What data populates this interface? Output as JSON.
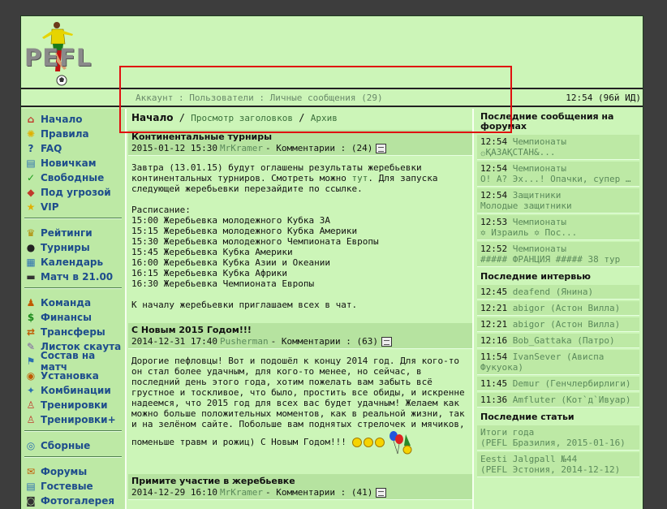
{
  "logo": {
    "text": "PEFL"
  },
  "topbar": {
    "links": [
      "Аккаунт",
      "Пользователи",
      "Личные сообщения"
    ],
    "separator": " : ",
    "messages_count": "(29)",
    "clock": "12:54 (96й ИД)"
  },
  "nav": {
    "groups": [
      [
        {
          "label": "Начало",
          "icon": "home-icon",
          "glyph": "⌂",
          "color": "#c0392b"
        },
        {
          "label": "Правила",
          "icon": "lightbulb-icon",
          "glyph": "✺",
          "color": "#e0b000"
        },
        {
          "label": "FAQ",
          "icon": "help-icon",
          "glyph": "?",
          "color": "#1e4d8c"
        },
        {
          "label": "Новичкам",
          "icon": "newbie-icon",
          "glyph": "▤",
          "color": "#2a6fb0"
        },
        {
          "label": "Свободные",
          "icon": "check-icon",
          "glyph": "✓",
          "color": "#1a9a1a"
        },
        {
          "label": "Под угрозой",
          "icon": "warning-icon",
          "glyph": "◆",
          "color": "#c0392b"
        },
        {
          "label": "VIP",
          "icon": "star-icon",
          "glyph": "★",
          "color": "#e0b000"
        }
      ],
      [
        {
          "label": "Рейтинги",
          "icon": "trophy-icon",
          "glyph": "♛",
          "color": "#b08a00"
        },
        {
          "label": "Турниры",
          "icon": "ball-icon",
          "glyph": "●",
          "color": "#222"
        },
        {
          "label": "Календарь",
          "icon": "calendar-icon",
          "glyph": "▦",
          "color": "#2a6fb0"
        },
        {
          "label": "Матч в 21.00",
          "icon": "tv-icon",
          "glyph": "▬",
          "color": "#333"
        }
      ],
      [
        {
          "label": "Команда",
          "icon": "team-icon",
          "glyph": "♟",
          "color": "#c05a00"
        },
        {
          "label": "Финансы",
          "icon": "money-icon",
          "glyph": "$",
          "color": "#1a8a1a"
        },
        {
          "label": "Трансферы",
          "icon": "transfer-icon",
          "glyph": "⇄",
          "color": "#c05a00"
        },
        {
          "label": "Листок скаута",
          "icon": "scout-icon",
          "glyph": "✎",
          "color": "#7a5aa0"
        },
        {
          "label": "Состав на матч",
          "icon": "lineup-icon",
          "glyph": "⚑",
          "color": "#2a6fb0"
        },
        {
          "label": "Установка",
          "icon": "tactics-icon",
          "glyph": "◉",
          "color": "#c05a00"
        },
        {
          "label": "Комбинации",
          "icon": "combo-icon",
          "glyph": "✦",
          "color": "#2a6fb0"
        },
        {
          "label": "Тренировки",
          "icon": "training-icon",
          "glyph": "♙",
          "color": "#c0392b"
        },
        {
          "label": "Тренировки+",
          "icon": "training-plus-icon",
          "glyph": "♙",
          "color": "#c0392b"
        }
      ],
      [
        {
          "label": "Сборные",
          "icon": "fifa-icon",
          "glyph": "◎",
          "color": "#2a6fb0"
        }
      ],
      [
        {
          "label": "Форумы",
          "icon": "forum-icon",
          "glyph": "✉",
          "color": "#c05a00"
        },
        {
          "label": "Гостевые",
          "icon": "guestbook-icon",
          "glyph": "▤",
          "color": "#2a6fb0"
        },
        {
          "label": "Фотогалерея",
          "icon": "camera-icon",
          "glyph": "◙",
          "color": "#333"
        }
      ]
    ]
  },
  "breadcrumb": {
    "home": "Начало",
    "sep": " / ",
    "items": [
      "Просмотр заголовков",
      "Архив"
    ]
  },
  "news": [
    {
      "title": "Континентальные турниры",
      "date": "2015-01-12 15:30",
      "author": "MrKramer",
      "comments_label": "- Комментарии :",
      "comments_count": "(24)",
      "intro_before": "Завтра (13.01.15) будут оглашены результаты жеребьевки континентальных турниров. Смотреть можно ",
      "intro_link": "тут",
      "intro_after": ". Для запуска следующей жеребьевки перезайдите по ссылке.",
      "schedule_title": "Расписание:",
      "schedule": [
        "15:00 Жеребьевка молодежного Кубка 3А",
        "15:15 Жеребьевка молодежного Кубка Америки",
        "15:30 Жеребьевка молодежного Чемпионата Европы",
        "15:45 Жеребьевка Кубка Америки",
        "16:00 Жеребьевка Кубка Азии и Океании",
        "16:15 Жеребьевка Кубка Африки",
        "16:30 Жеребьевка Чемпионата Европы"
      ],
      "outro": "К началу жеребьевки приглашаем всех в чат."
    },
    {
      "title": "С Новым 2015 Годом!!!",
      "date": "2014-12-31 17:40",
      "author": "Pusherman",
      "comments_label": "- Комментарии :",
      "comments_count": "(63)",
      "text": "Дорогие пефловцы! Вот и подошёл к концу 2014 год. Для кого-то он стал более удачным, для кого-то менее, но сейчас, в последний день этого года, хотим пожелать вам забыть всё грустное и тоскливое, что было, простить все обиды, и искренне надеемся, что 2015 год для всех вас будет удачным! Желаем как можно больше положительных моментов, как в реальной жизни, так и на зелёном сайте. Побольше вам поднятых стрелочек и мячиков, поменьше травм и рожиц) С Новым Годом!!!"
    },
    {
      "title": "Примите участие в жеребьевке",
      "date": "2014-12-29 16:10",
      "author": "MrKramer",
      "comments_label": "- Комментарии :",
      "comments_count": "(41)"
    }
  ],
  "right": {
    "forum_heading": "Последние сообщения на форумах",
    "forum": [
      {
        "time": "12:54",
        "cat": "Чемпионаты",
        "sub": "۞ҚАЗАҚСТАН&..."
      },
      {
        "time": "12:54",
        "cat": "Чемпионаты",
        "sub": "О! А? Эх...! Опачки, супер ин..."
      },
      {
        "time": "12:54",
        "cat": "Защитники",
        "sub": "Молодые защитники"
      },
      {
        "time": "12:53",
        "cat": "Чемпионаты",
        "sub": "✡ Израиль ✡ Пос..."
      },
      {
        "time": "12:52",
        "cat": "Чемпионаты",
        "sub": "##### ФРАНЦИЯ ##### 38 тур"
      }
    ],
    "interviews_heading": "Последние интервью",
    "interviews": [
      {
        "time": "12:45",
        "text": "deafend (Янина)"
      },
      {
        "time": "12:21",
        "text": "abigor (Астон Вилла)"
      },
      {
        "time": "12:21",
        "text": "abigor (Астон Вилла)"
      },
      {
        "time": "12:16",
        "text": "Bob_Gattaka (Патро)"
      },
      {
        "time": "11:54",
        "text": "IvanSever (Ависпа Фукуока)"
      },
      {
        "time": "11:45",
        "text": "Demur (Генчлербирлиги)"
      },
      {
        "time": "11:36",
        "text": "Amfluter (Кот`д`Ивуар)"
      }
    ],
    "articles_heading": "Последние статьи",
    "articles": [
      {
        "title": "Итоги года",
        "meta": "(PEFL Бразилия, 2015-01-16)"
      },
      {
        "title": "Eesti Jalgpall №44",
        "meta": "(PEFL Эстония, 2014-12-12)"
      }
    ]
  }
}
